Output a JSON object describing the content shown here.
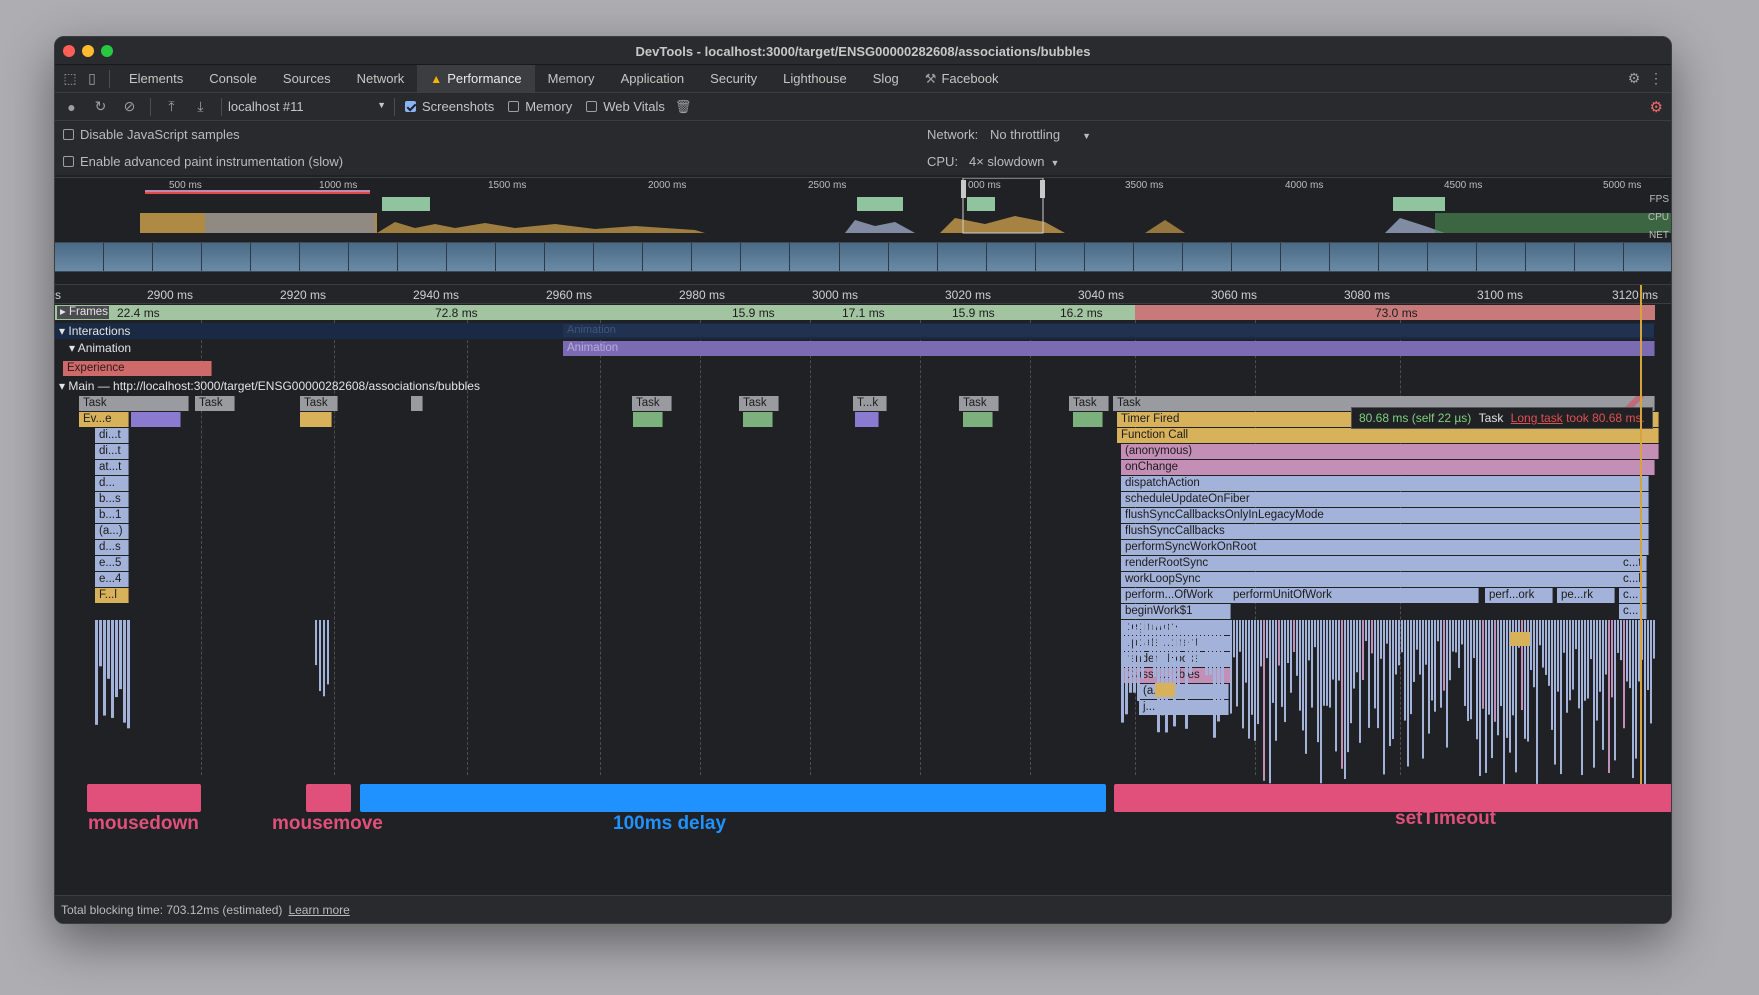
{
  "window": {
    "title": "DevTools - localhost:3000/target/ENSG00000282608/associations/bubbles"
  },
  "tabs": [
    "Elements",
    "Console",
    "Sources",
    "Network",
    "Performance",
    "Memory",
    "Application",
    "Security",
    "Lighthouse",
    "Slog",
    "Facebook"
  ],
  "active_tab": "Performance",
  "toolbar": {
    "profile": "localhost #11",
    "screenshots": "Screenshots",
    "memory": "Memory",
    "web_vitals": "Web Vitals"
  },
  "settings": {
    "disable_js": "Disable JavaScript samples",
    "advanced_paint": "Enable advanced paint instrumentation (slow)",
    "network_label": "Network:",
    "network_value": "No throttling",
    "cpu_label": "CPU:",
    "cpu_value": "4× slowdown"
  },
  "overview": {
    "ticks": [
      "500 ms",
      "1000 ms",
      "1500 ms",
      "2000 ms",
      "2500 ms",
      "000 ms",
      "3500 ms",
      "4000 ms",
      "4500 ms",
      "5000 ms"
    ],
    "lanes": [
      "FPS",
      "CPU",
      "NET"
    ]
  },
  "ruler": {
    "ticks": [
      "s",
      "2900 ms",
      "2920 ms",
      "2940 ms",
      "2960 ms",
      "2980 ms",
      "3000 ms",
      "3020 ms",
      "3040 ms",
      "3060 ms",
      "3080 ms",
      "3100 ms",
      "3120 ms"
    ]
  },
  "frames": {
    "label": "Frames",
    "values": [
      "22.4 ms",
      "72.8 ms",
      "15.9 ms",
      "17.1 ms",
      "15.9 ms",
      "16.2 ms",
      "73.0 ms"
    ]
  },
  "tracks": {
    "interactions": "Interactions",
    "animation": "Animation",
    "animation_bar": "Animation",
    "animation_bar_faded": "Animation",
    "experience": "Experience",
    "main": "Main — http://localhost:3000/target/ENSG00000282608/associations/bubbles"
  },
  "left_stack": [
    "Ev...e",
    "di...t",
    "di...t",
    "at...t",
    "d...",
    "b...s",
    "b...1",
    "(a...)",
    "d...s",
    "e...5",
    "e...4",
    "F...l"
  ],
  "tasks": [
    "Task",
    "Task",
    "Task",
    "Task",
    "Task",
    "T...k",
    "Task",
    "Task",
    "Task"
  ],
  "main_stack": [
    "Timer Fired",
    "Function Call",
    "(anonymous)",
    "onChange",
    "dispatchAction",
    "scheduleUpdateOnFiber",
    "flushSyncCallbacksOnlyInLegacyMode",
    "flushSyncCallbacks",
    "performSyncWorkOnRoot",
    "renderRootSync",
    "workLoopSync",
    "perform...OfWork",
    "beginWork$1",
    "beginWork",
    "update...onent",
    "render...Hooks",
    "Classi...ubbles",
    "(a...s)",
    "j..."
  ],
  "secondary": {
    "performUnitOfWork": "performUnitOfWork",
    "perf_ork": "perf...ork",
    "pe_rk": "pe...rk",
    "c_t": "c...t",
    "c_l": "c...l",
    "c1": "c...",
    "c2": "c..."
  },
  "tooltip": {
    "time": "80.68 ms (self 22 µs)",
    "kind": "Task",
    "link": "Long task",
    "rest": "took 80.68 ms."
  },
  "annotations": {
    "mousedown": "mousedown",
    "mousemove": "mousemove",
    "delay": "100ms delay",
    "settimeout": "setTimeout"
  },
  "status": {
    "text": "Total blocking time: 703.12ms (estimated)",
    "link": "Learn more"
  },
  "colors": {
    "yellow": "#d8b25a",
    "blue": "#a3b2d8",
    "pink": "#c48fb7",
    "red": "#e0507a",
    "annotation_blue": "#1f92ff",
    "frame_green": "#a2c4a0",
    "frame_red": "#c87a7a"
  }
}
